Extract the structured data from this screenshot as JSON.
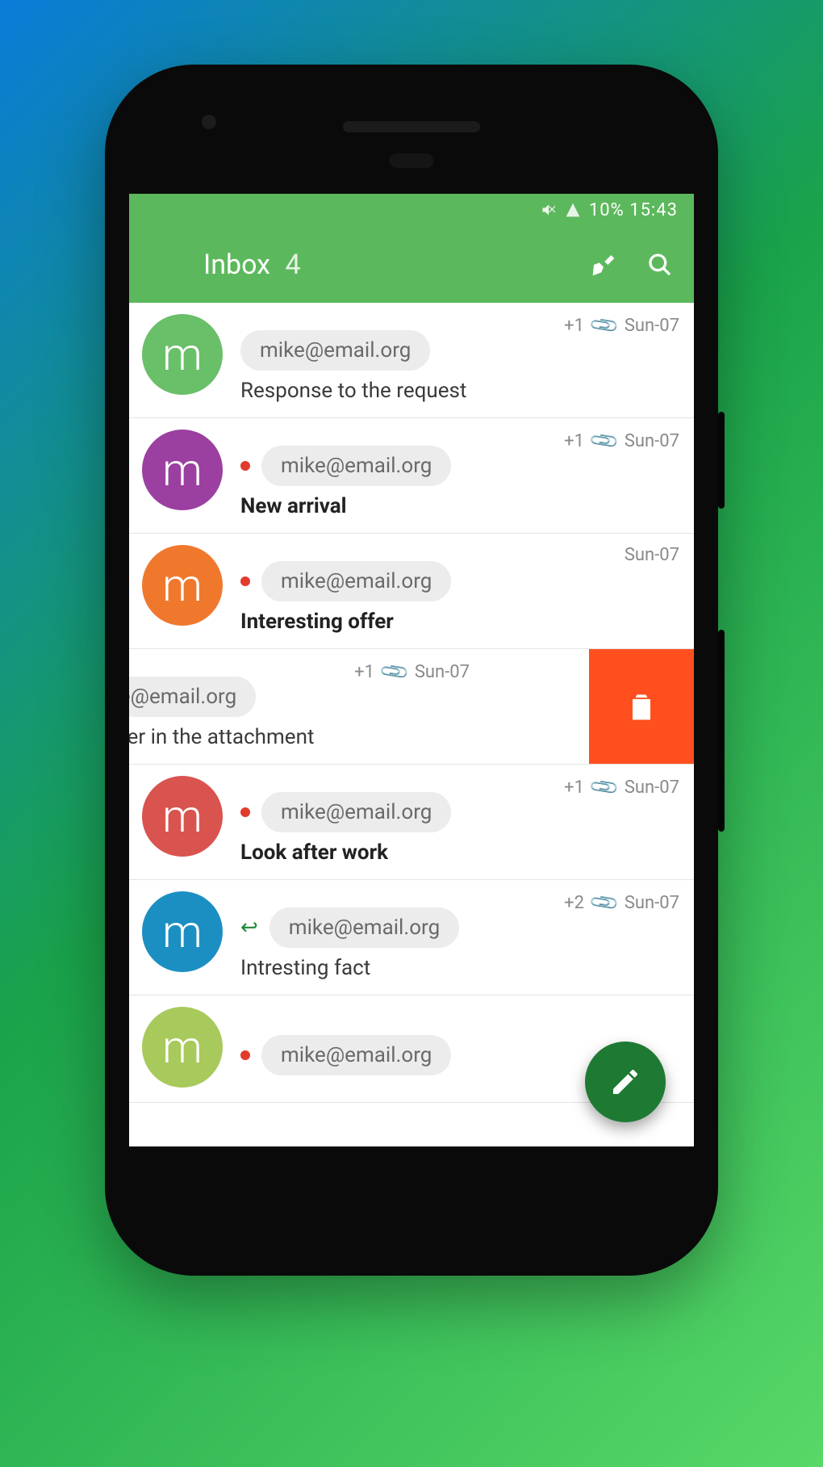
{
  "status": {
    "right": "10% 15:43"
  },
  "appbar": {
    "title": "Inbox",
    "count": "4"
  },
  "emails": [
    {
      "avatar_color": "#6abf69",
      "letter": "m",
      "extra": "+1",
      "has_clip": true,
      "date": "Sun-07",
      "unread": false,
      "reply": false,
      "sender": "mike@email.org",
      "subject": "Response to the request",
      "bold": false,
      "swiped": false
    },
    {
      "avatar_color": "#9b3fa0",
      "letter": "m",
      "extra": "+1",
      "has_clip": true,
      "date": "Sun-07",
      "unread": true,
      "reply": false,
      "sender": "mike@email.org",
      "subject": "New arrival",
      "bold": true,
      "swiped": false
    },
    {
      "avatar_color": "#f0782d",
      "letter": "m",
      "extra": "",
      "has_clip": false,
      "date": "Sun-07",
      "unread": true,
      "reply": false,
      "sender": "mike@email.org",
      "subject": "Interesting offer",
      "bold": true,
      "swiped": false
    },
    {
      "avatar_color": "",
      "letter": "",
      "extra": "+1",
      "has_clip": true,
      "date": "Sun-07",
      "unread": false,
      "reply": true,
      "sender": "mike@email.org",
      "subject": "The answer in the attachment",
      "bold": false,
      "swiped": true
    },
    {
      "avatar_color": "#d9534f",
      "letter": "m",
      "extra": "+1",
      "has_clip": true,
      "date": "Sun-07",
      "unread": true,
      "reply": false,
      "sender": "mike@email.org",
      "subject": "Look after work",
      "bold": true,
      "swiped": false
    },
    {
      "avatar_color": "#1c8fc2",
      "letter": "m",
      "extra": "+2",
      "has_clip": true,
      "date": "Sun-07",
      "unread": false,
      "reply": true,
      "sender": "mike@email.org",
      "subject": "Intresting fact",
      "bold": false,
      "swiped": false
    },
    {
      "avatar_color": "#a8c95b",
      "letter": "m",
      "extra": "",
      "has_clip": false,
      "date": "",
      "unread": true,
      "reply": false,
      "sender": "mike@email.org",
      "subject": "",
      "bold": false,
      "swiped": false
    }
  ]
}
